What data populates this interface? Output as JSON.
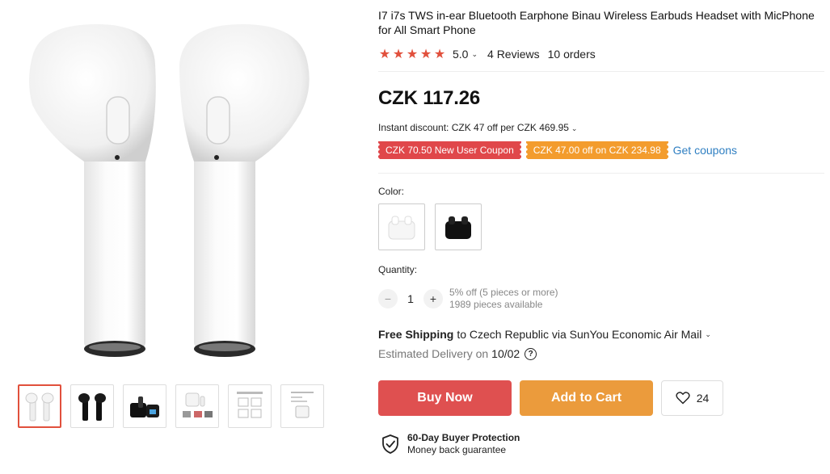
{
  "product": {
    "title": "I7 i7s TWS in-ear Bluetooth Earphone Binau Wireless Earbuds Headset with MicPhone for All Smart Phone",
    "rating": {
      "value": "5.0",
      "stars": 5,
      "reviews": "4 Reviews",
      "orders": "10 orders"
    },
    "price": "CZK 117.26",
    "instant_discount": "Instant discount: CZK 47 off per CZK 469.95",
    "coupons": [
      {
        "label": "CZK 70.50 New User Coupon",
        "color": "#e0474a"
      },
      {
        "label": "CZK 47.00 off on CZK 234.98",
        "color": "#f39c2d"
      }
    ],
    "get_coupons": "Get coupons",
    "color_label": "Color:",
    "colors": [
      "white",
      "black"
    ],
    "quantity_label": "Quantity:",
    "quantity": "1",
    "quantity_discount": "5% off (5 pieces or more)",
    "available": "1989 pieces available",
    "shipping": {
      "strong": "Free Shipping",
      "rest": "to Czech Republic via SunYou Economic Air Mail"
    },
    "delivery": {
      "label": "Estimated Delivery on",
      "date": "10/02"
    },
    "buttons": {
      "buy": "Buy Now",
      "cart": "Add to Cart",
      "wishlist_count": "24"
    },
    "protection": {
      "title": "60-Day Buyer Protection",
      "subtitle": "Money back guarantee"
    }
  },
  "gallery": {
    "thumbnails": [
      "white-earbuds",
      "black-earbuds",
      "black-with-case",
      "white-with-case",
      "instructions",
      "manual"
    ],
    "active_index": 0
  },
  "colors": {
    "accent_red": "#e1503c",
    "buy_button": "#df5050",
    "cart_button": "#eb9b3c",
    "link_blue": "#2f7fc2"
  },
  "icons": [
    "star-icon",
    "chevron-down-icon",
    "minus-icon",
    "plus-icon",
    "help-icon",
    "heart-icon",
    "shield-check-icon"
  ]
}
